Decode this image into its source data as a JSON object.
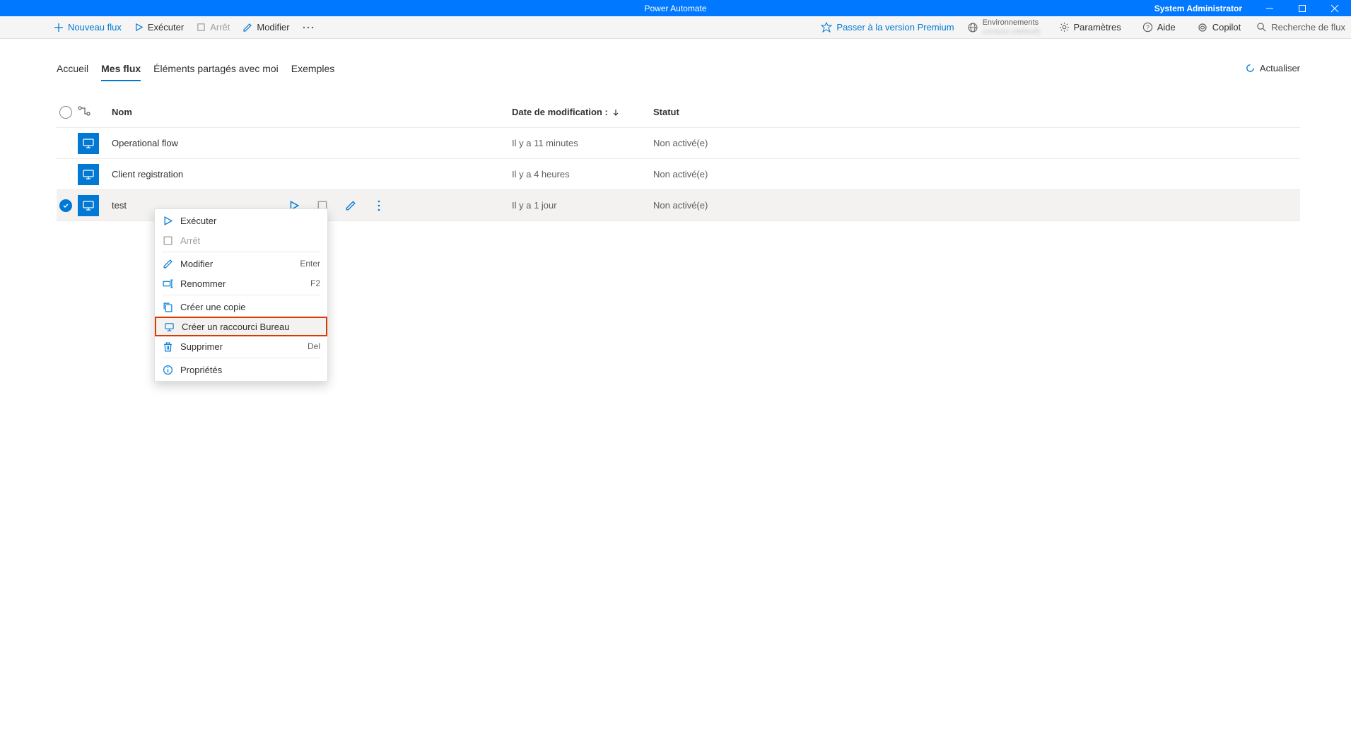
{
  "titlebar": {
    "title": "Power Automate",
    "user": "System Administrator"
  },
  "commandbar": {
    "new_flow": "Nouveau flux",
    "run": "Exécuter",
    "stop": "Arrêt",
    "edit": "Modifier",
    "premium": "Passer à la version Premium",
    "env_label": "Environnements",
    "env_name": "contoso (default)",
    "settings": "Paramètres",
    "help": "Aide",
    "copilot": "Copilot",
    "search_placeholder": "Recherche de flux"
  },
  "tabs": {
    "home": "Accueil",
    "my_flows": "Mes flux",
    "shared": "Éléments partagés avec moi",
    "examples": "Exemples"
  },
  "refresh": "Actualiser",
  "columns": {
    "name": "Nom",
    "modified": "Date de modification :",
    "status": "Statut"
  },
  "flows": [
    {
      "name": "Operational flow",
      "modified": "Il y a 11 minutes",
      "status": "Non activé(e)",
      "selected": false
    },
    {
      "name": "Client registration",
      "modified": "Il y a 4 heures",
      "status": "Non activé(e)",
      "selected": false
    },
    {
      "name": "test",
      "modified": "Il y a 1 jour",
      "status": "Non activé(e)",
      "selected": true
    }
  ],
  "context_menu": {
    "run": "Exécuter",
    "stop": "Arrêt",
    "edit": "Modifier",
    "edit_shortcut": "Enter",
    "rename": "Renommer",
    "rename_shortcut": "F2",
    "copy": "Créer une copie",
    "shortcut": "Créer un raccourci Bureau",
    "delete": "Supprimer",
    "delete_shortcut": "Del",
    "properties": "Propriétés"
  }
}
